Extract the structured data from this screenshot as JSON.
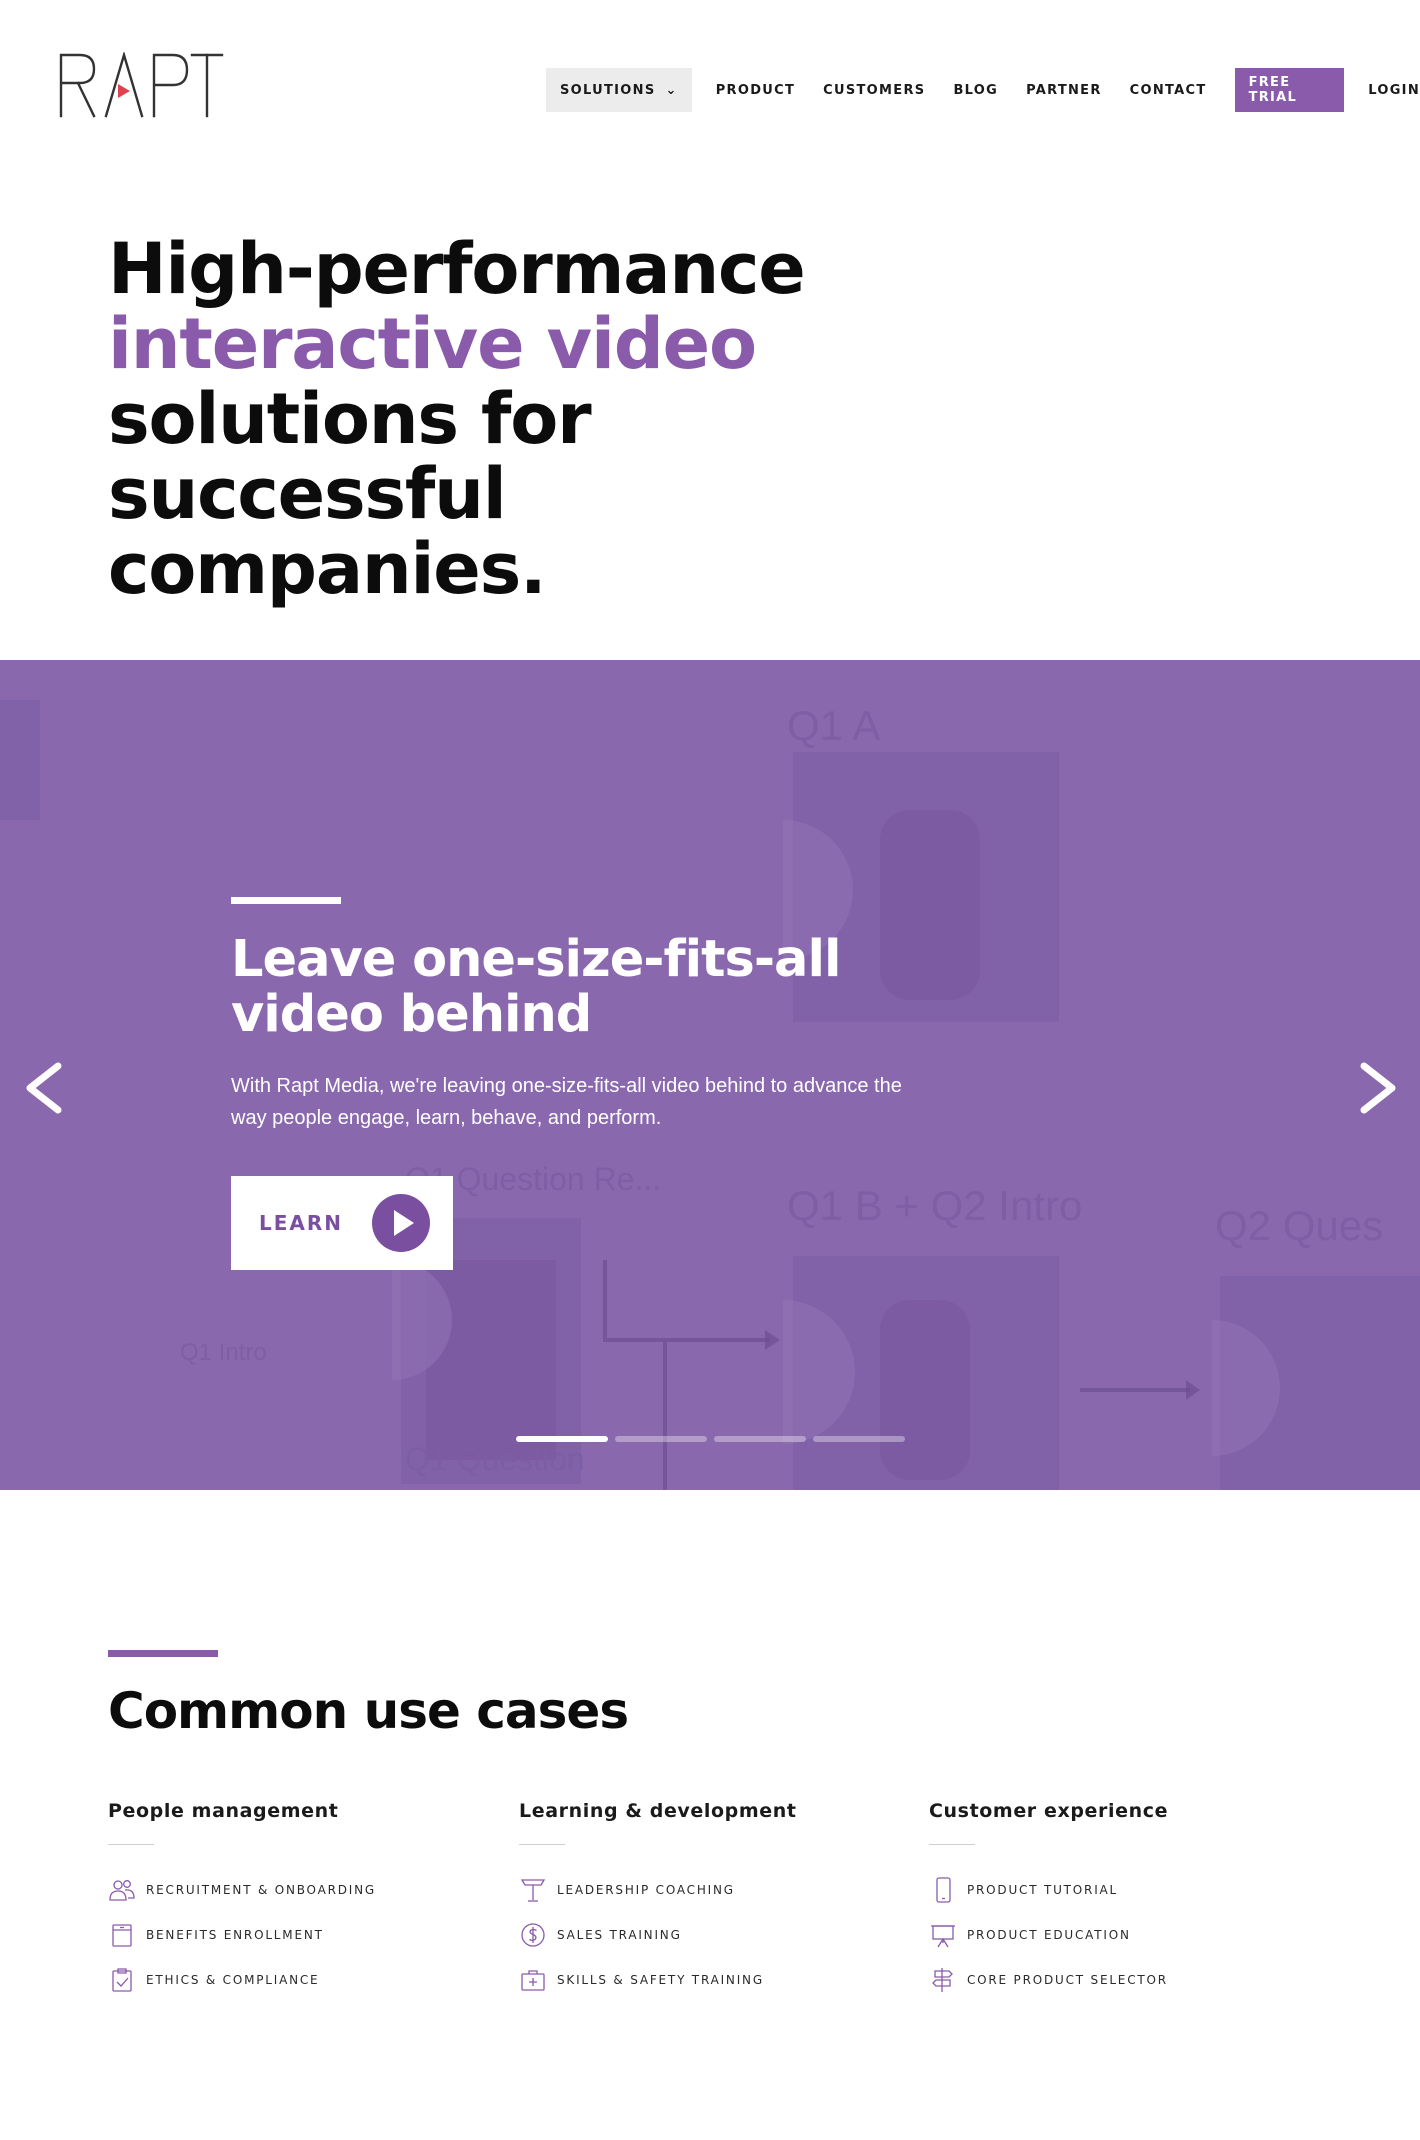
{
  "brand": {
    "name": "RAPT",
    "accent": "#8a5aab",
    "slider_bg": "#8a68ad"
  },
  "nav": {
    "solutions": "SOLUTIONS",
    "product": "PRODUCT",
    "customers": "CUSTOMERS",
    "blog": "BLOG",
    "partner": "PARTNER",
    "contact": "CONTACT",
    "free_trial": "FREE TRIAL",
    "login": "LOGIN"
  },
  "hero": {
    "line1": "High-performance",
    "line2": "interactive video",
    "line3": "solutions for successful",
    "line4": "companies."
  },
  "slider": {
    "title_line1": "Leave one-size-fits-all",
    "title_line2": "video behind",
    "text": "With Rapt Media, we're leaving one-size-fits-all video behind to advance the way people engage, learn, behave, and perform.",
    "button_label": "LEARN",
    "background_labels": [
      "Q1 A",
      "Q1 Question Re...",
      "Q1 B + Q2 Intro",
      "Q2 Ques",
      "Q1 Question",
      "Q1 Intro"
    ],
    "slide_count": 4,
    "active_slide": 1
  },
  "use_cases": {
    "title": "Common use cases",
    "columns": [
      {
        "heading": "People management",
        "items": [
          {
            "label": "RECRUITMENT & ONBOARDING",
            "icon": "people-icon"
          },
          {
            "label": "BENEFITS ENROLLMENT",
            "icon": "box-icon"
          },
          {
            "label": "ETHICS & COMPLIANCE",
            "icon": "checklist-icon"
          }
        ]
      },
      {
        "heading": "Learning & development",
        "items": [
          {
            "label": "LEADERSHIP COACHING",
            "icon": "podium-icon"
          },
          {
            "label": "SALES TRAINING",
            "icon": "dollar-icon"
          },
          {
            "label": "SKILLS & SAFETY TRAINING",
            "icon": "first-aid-icon"
          }
        ]
      },
      {
        "heading": "Customer experience",
        "items": [
          {
            "label": "PRODUCT TUTORIAL",
            "icon": "phone-icon"
          },
          {
            "label": "PRODUCT EDUCATION",
            "icon": "easel-icon"
          },
          {
            "label": "CORE PRODUCT SELECTOR",
            "icon": "signpost-icon"
          }
        ]
      }
    ]
  }
}
